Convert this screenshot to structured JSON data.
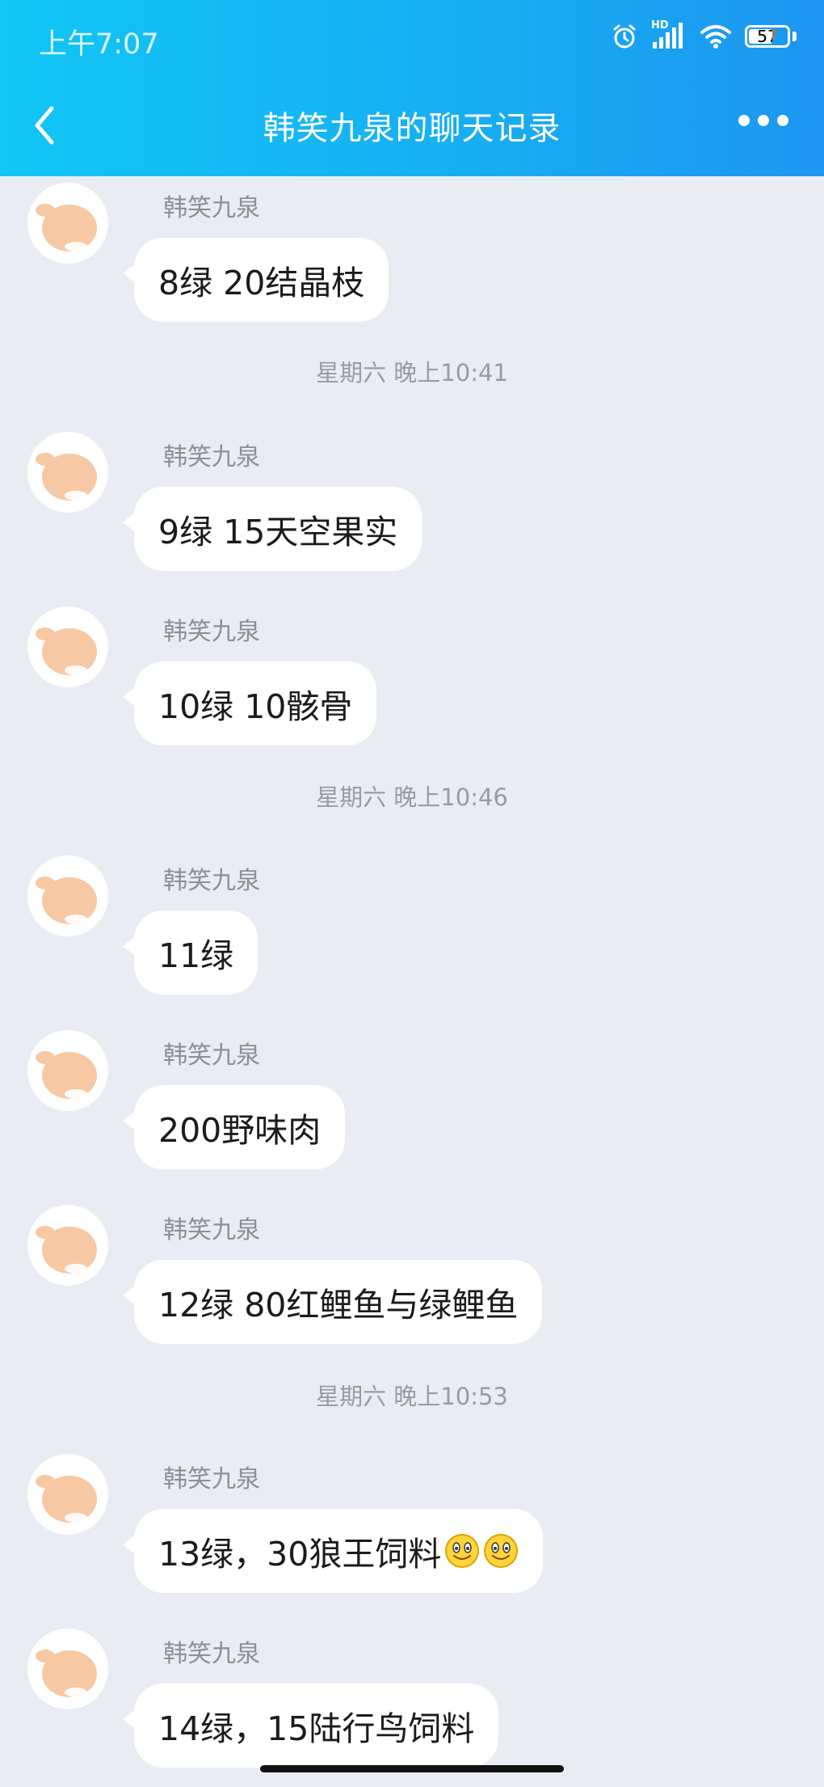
{
  "status_bar": {
    "time": "上午7:07",
    "battery": "57",
    "network": "HD"
  },
  "header": {
    "title": "韩笑九泉的聊天记录"
  },
  "messages": [
    {
      "sender": "韩笑九泉",
      "text": "8绿 20结晶枝"
    },
    {
      "sender": "韩笑九泉",
      "text": "9绿 15天空果实"
    },
    {
      "sender": "韩笑九泉",
      "text": "10绿 10骸骨"
    },
    {
      "sender": "韩笑九泉",
      "text": "11绿"
    },
    {
      "sender": "韩笑九泉",
      "text": "200野味肉"
    },
    {
      "sender": "韩笑九泉",
      "text": "12绿 80红鲤鱼与绿鲤鱼"
    },
    {
      "sender": "韩笑九泉",
      "text": "13绿，30狼王饲料"
    },
    {
      "sender": "韩笑九泉",
      "text": "14绿，15陆行鸟饲料"
    }
  ],
  "timestamps": [
    "星期六 晚上10:41",
    "星期六 晚上10:46",
    "星期六 晚上10:53"
  ],
  "colors": {
    "header_start": "#12c6f5",
    "header_end": "#1d96f0",
    "chat_background": "#eaecf4",
    "bubble": "#ffffff",
    "avatar_skin": "#f6c9a4"
  },
  "icons": {
    "emoji": "smiley-emoji",
    "avatar": "cartoon-avatar"
  }
}
